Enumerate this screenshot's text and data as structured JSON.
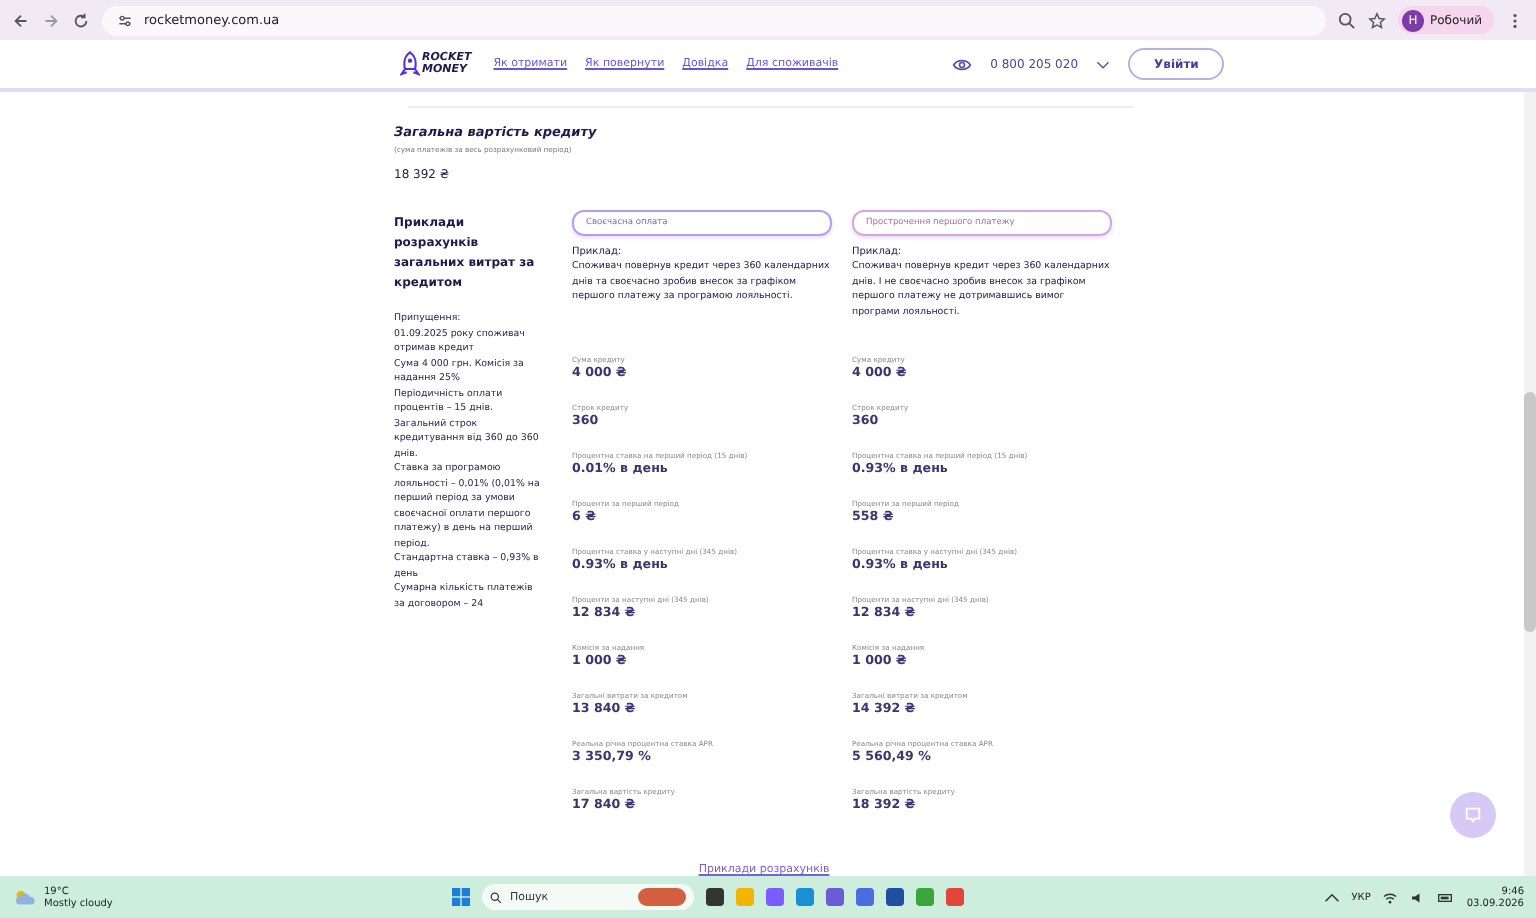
{
  "browser": {
    "url": "rocketmoney.com.ua",
    "profile_initial": "Н",
    "profile_name": "Робочий"
  },
  "header": {
    "logo": [
      "ROCKET",
      "MONEY"
    ],
    "nav": [
      "Як отримати",
      "Як повернути",
      "Довідка",
      "Для споживачів"
    ],
    "phone": "0 800 205 020",
    "login": "Увійти"
  },
  "total": {
    "title": "Загальна вартість кредиту",
    "note": "(сума платежів за весь розрахунковий період)",
    "value": "18 392 ₴"
  },
  "examples": {
    "title": "Приклади розрахунків загальних витрат за кредитом",
    "assumptions": [
      "Припущення:",
      "01.09.2025 року споживач отримав кредит",
      "Сума 4 000 грн. Комісія за надання 25%",
      "Періодичність оплати процентів – 15 днів.",
      "Загальний строк кредитування від 360 до 360 днів.",
      "Ставка за програмою лояльності – 0,01% (0,01% на перший період за умови своєчасної оплати першого платежу) в день на перший період.",
      "Стандартна ставка – 0,93% в день",
      "Сумарна кількість платежів за договором – 24"
    ],
    "columns": [
      {
        "tab": "Своєчасна оплата",
        "example_label": "Приклад:",
        "example": "Споживач повернув кредит через 360 календарних днів та своєчасно зробив внесок за графіком першого платежу за програмою лояльності.",
        "fields": [
          {
            "label": "Сума кредиту",
            "value": "4 000 ₴"
          },
          {
            "label": "Строк кредиту",
            "value": "360"
          },
          {
            "label": "Процентна ставка на перший період (15 днів)",
            "value": "0.01% в день"
          },
          {
            "label": "Проценти за перший період",
            "value": "6 ₴"
          },
          {
            "label": "Процентна ставка у наступні дні (345 днів)",
            "value": "0.93% в день"
          },
          {
            "label": "Проценти за наступні дні (345 днів)",
            "value": "12 834 ₴"
          },
          {
            "label": "Комісія за надання",
            "value": "1 000 ₴"
          },
          {
            "label": "Загальні витрати за кредитом",
            "value": "13 840 ₴"
          },
          {
            "label": "Реальна річна процентна ставка APR",
            "value": "3 350,79 %"
          },
          {
            "label": "Загальна вартість кредиту",
            "value": "17 840 ₴"
          }
        ]
      },
      {
        "tab": "Прострочення першого платежу",
        "example_label": "Приклад:",
        "example": "Споживач повернув кредит через 360 календарних днів. І не своєчасно зробив внесок за графіком першого платежу не дотримавшись вимог програми лояльності.",
        "fields": [
          {
            "label": "Сума кредиту",
            "value": "4 000 ₴"
          },
          {
            "label": "Строк кредиту",
            "value": "360"
          },
          {
            "label": "Процентна ставка на перший період (15 днів)",
            "value": "0.93% в день"
          },
          {
            "label": "Проценти за перший період",
            "value": "558 ₴"
          },
          {
            "label": "Процентна ставка у наступні дні (345 днів)",
            "value": "0.93% в день"
          },
          {
            "label": "Проценти за наступні дні (345 днів)",
            "value": "12 834 ₴"
          },
          {
            "label": "Комісія за надання",
            "value": "1 000 ₴"
          },
          {
            "label": "Загальні витрати за кредитом",
            "value": "14 392 ₴"
          },
          {
            "label": "Реальна річна процентна ставка APR",
            "value": "5 560,49 %"
          },
          {
            "label": "Загальна вартість кредиту",
            "value": "18 392 ₴"
          }
        ]
      }
    ],
    "link": "Приклади розрахунків"
  },
  "taskbar": {
    "temperature": "19°C",
    "weather": "Mostly cloudy",
    "search_placeholder": "Пошук",
    "language": "УКР",
    "time": "9:46",
    "date": "03.09.2026"
  }
}
